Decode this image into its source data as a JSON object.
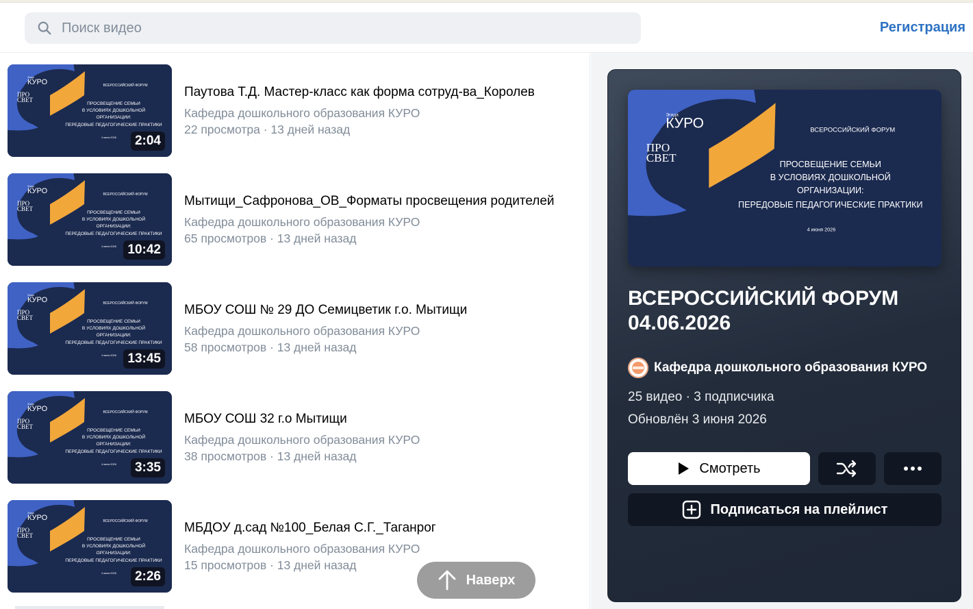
{
  "search": {
    "placeholder": "Поиск видео"
  },
  "header": {
    "register_label": "Регистрация"
  },
  "thumbnail": {
    "brand_small": "Эгида",
    "brand": "КУРО",
    "logo_line1": "ПРО",
    "logo_line2": "СВЕТ",
    "forum": "ВСЕРОССИЙСКИЙ ФОРУМ",
    "line1": "ПРОСВЕЩЕНИЕ СЕМЬИ",
    "line2": "В УСЛОВИЯХ ДОШКОЛЬНОЙ",
    "line3": "ОРГАНИЗАЦИИ:",
    "line4": "ПЕРЕДОВЫЕ ПЕДАГОГИЧЕСКИЕ ПРАКТИКИ",
    "date": "4 июня 2026"
  },
  "videos": [
    {
      "title": "Паутова Т.Д. Мастер-класс как форма сотруд-ва_Королев",
      "channel": "Кафедра дошкольного образования КУРО",
      "meta": "22 просмотра · 13 дней назад",
      "duration": "2:04"
    },
    {
      "title": "Мытищи_Сафронова_ОВ_Форматы просвещения родителей",
      "channel": "Кафедра дошкольного образования КУРО",
      "meta": "65 просмотров · 13 дней назад",
      "duration": "10:42"
    },
    {
      "title": "МБОУ СОШ № 29 ДО Семицветик г.о. Мытищи",
      "channel": "Кафедра дошкольного образования КУРО",
      "meta": "58 просмотров · 13 дней назад",
      "duration": "13:45"
    },
    {
      "title": "МБОУ СОШ 32 г.о Мытищи",
      "channel": "Кафедра дошкольного образования КУРО",
      "meta": "38 просмотров · 13 дней назад",
      "duration": "3:35"
    },
    {
      "title": "МБДОУ д.сад №100_Белая С.Г._Таганрог",
      "channel": "Кафедра дошкольного образования КУРО",
      "meta": "15 просмотров · 13 дней назад",
      "duration": "2:26"
    }
  ],
  "scroll_up": {
    "label": "Наверх"
  },
  "playlist": {
    "title_line1": "ВСЕРОССИЙСКИЙ ФОРУМ",
    "title_line2": "04.06.2026",
    "owner": "Кафедра дошкольного образования КУРО",
    "stats": "25 видео · 3 подписчика",
    "updated": "Обновлён 3 июня 2026",
    "watch_label": "Смотреть",
    "subscribe_label": "Подписаться на плейлист"
  },
  "colors": {
    "accent_link": "#2d72c3",
    "thumb_bg": "#1b2a4f",
    "thumb_blue": "#3f62c4",
    "thumb_orange": "#f2a73b",
    "secondary_text": "#818c99"
  }
}
